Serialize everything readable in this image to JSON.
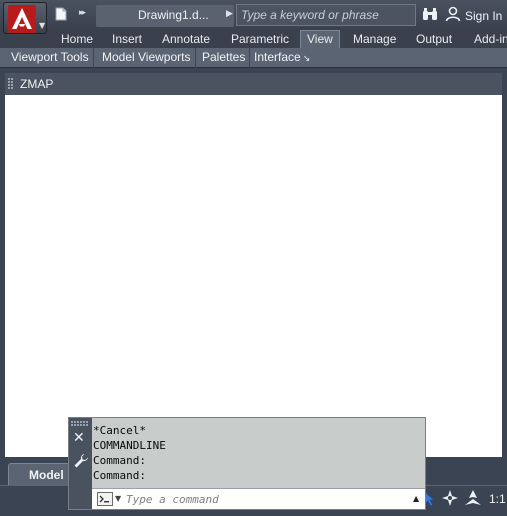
{
  "title_bar": {
    "document_title": "Drawing1.d...",
    "search_placeholder": "Type a keyword or phrase",
    "sign_in_label": "Sign In"
  },
  "ribbon": {
    "tabs": [
      {
        "label": "Home"
      },
      {
        "label": "Insert"
      },
      {
        "label": "Annotate"
      },
      {
        "label": "Parametric"
      },
      {
        "label": "View",
        "active": true
      },
      {
        "label": "Manage"
      },
      {
        "label": "Output"
      },
      {
        "label": "Add-in"
      }
    ],
    "panels": [
      {
        "label": "Viewport Tools"
      },
      {
        "label": "Model Viewports"
      },
      {
        "label": "Palettes"
      },
      {
        "label": "Interface"
      }
    ]
  },
  "command_title": "ZMAP",
  "layout_tabs": {
    "model_label": "Model"
  },
  "status_bar": {
    "scale_label": "1:1"
  },
  "command_line": {
    "history": [
      "*Cancel*",
      "COMMANDLINE",
      "Command:",
      "Command:"
    ],
    "input_placeholder": "Type a command"
  },
  "icons": {
    "app": "autocad-logo-icon",
    "new": "new-drawing-icon",
    "search_tools": "binoculars-icon",
    "user": "user-icon",
    "close": "close-icon",
    "customize": "wrench-icon",
    "prompt": "command-prompt-icon"
  },
  "colors": {
    "accent_red": "#c62828",
    "chrome_dark": "#3b4452",
    "panel_bar": "#5b6473",
    "canvas": "#ffffff",
    "command_history_bg": "#c8ccca"
  }
}
